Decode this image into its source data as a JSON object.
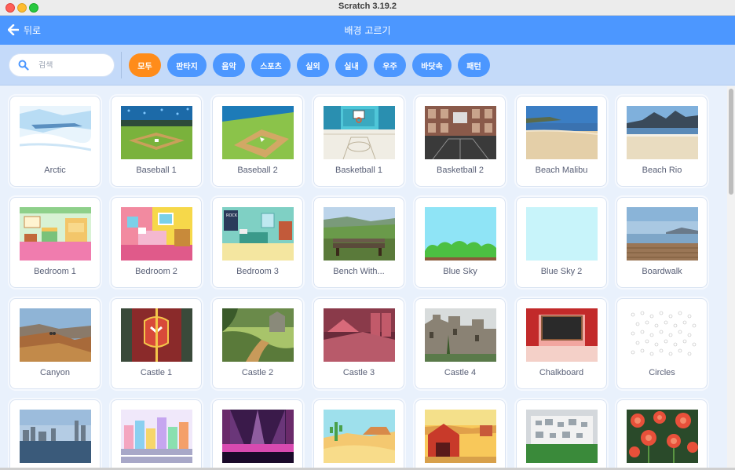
{
  "window": {
    "title": "Scratch 3.19.2"
  },
  "header": {
    "back_label": "뒤로",
    "title": "배경 고르기"
  },
  "search": {
    "placeholder": "검색"
  },
  "tags": [
    {
      "label": "모두",
      "active": true
    },
    {
      "label": "판타지",
      "active": false
    },
    {
      "label": "음악",
      "active": false
    },
    {
      "label": "스포츠",
      "active": false
    },
    {
      "label": "실외",
      "active": false
    },
    {
      "label": "실내",
      "active": false
    },
    {
      "label": "우주",
      "active": false
    },
    {
      "label": "바닷속",
      "active": false
    },
    {
      "label": "패턴",
      "active": false
    }
  ],
  "colors": {
    "header": "#4c97ff",
    "filterbar": "#c4daf9",
    "active_tag": "#ff8c1a",
    "tag": "#4c97ff",
    "background": "#e9f1fc"
  },
  "backdrops": [
    {
      "name": "Arctic",
      "thumb": "arctic"
    },
    {
      "name": "Baseball 1",
      "thumb": "baseball1"
    },
    {
      "name": "Baseball 2",
      "thumb": "baseball2"
    },
    {
      "name": "Basketball 1",
      "thumb": "basketball1"
    },
    {
      "name": "Basketball 2",
      "thumb": "basketball2"
    },
    {
      "name": "Beach Malibu",
      "thumb": "beach-malibu"
    },
    {
      "name": "Beach Rio",
      "thumb": "beach-rio"
    },
    {
      "name": "Bedroom 1",
      "thumb": "bedroom1"
    },
    {
      "name": "Bedroom 2",
      "thumb": "bedroom2"
    },
    {
      "name": "Bedroom 3",
      "thumb": "bedroom3"
    },
    {
      "name": "Bench With...",
      "thumb": "bench"
    },
    {
      "name": "Blue Sky",
      "thumb": "blue-sky"
    },
    {
      "name": "Blue Sky 2",
      "thumb": "blue-sky-2"
    },
    {
      "name": "Boardwalk",
      "thumb": "boardwalk"
    },
    {
      "name": "Canyon",
      "thumb": "canyon"
    },
    {
      "name": "Castle 1",
      "thumb": "castle1"
    },
    {
      "name": "Castle 2",
      "thumb": "castle2"
    },
    {
      "name": "Castle 3",
      "thumb": "castle3"
    },
    {
      "name": "Castle 4",
      "thumb": "castle4"
    },
    {
      "name": "Chalkboard",
      "thumb": "chalkboard"
    },
    {
      "name": "Circles",
      "thumb": "circles"
    },
    {
      "name": "",
      "thumb": "city"
    },
    {
      "name": "",
      "thumb": "colorful-city"
    },
    {
      "name": "",
      "thumb": "concert"
    },
    {
      "name": "",
      "thumb": "desert"
    },
    {
      "name": "",
      "thumb": "farm"
    },
    {
      "name": "",
      "thumb": "building"
    },
    {
      "name": "",
      "thumb": "flowers"
    }
  ]
}
